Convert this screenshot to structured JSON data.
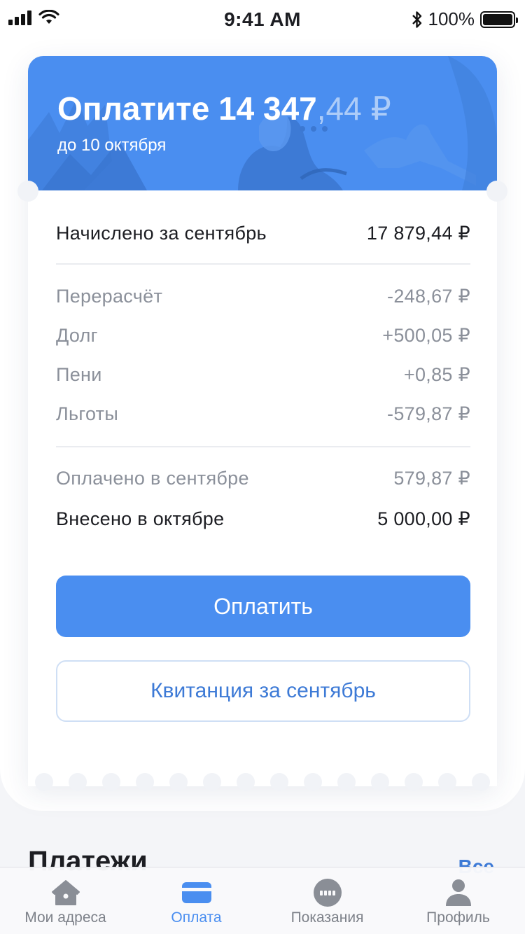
{
  "status_bar": {
    "time": "9:41 AM",
    "battery": "100%"
  },
  "banner": {
    "title_main": "Оплатите 14 347",
    "title_cents": ",44 ₽",
    "subtitle": "до 10 октября"
  },
  "charges": {
    "accrued": {
      "label": "Начислено за сентябрь",
      "value": "17 879,44 ₽"
    },
    "details": [
      {
        "label": "Перерасчёт",
        "value": "-248,67 ₽"
      },
      {
        "label": "Долг",
        "value": "+500,05 ₽"
      },
      {
        "label": "Пени",
        "value": "+0,85 ₽"
      },
      {
        "label": "Льготы",
        "value": "-579,87 ₽"
      }
    ],
    "paid_september": {
      "label": "Оплачено в сентябре",
      "value": "579,87 ₽"
    },
    "paid_october": {
      "label": "Внесено в октябре",
      "value": "5 000,00 ₽"
    }
  },
  "actions": {
    "pay_label": "Оплатить",
    "receipt_label": "Квитанция за сентябрь"
  },
  "payments_section": {
    "title": "Платежи",
    "link": "Все"
  },
  "tabbar": {
    "items": [
      {
        "label": "Мои адреса",
        "icon": "home-icon",
        "active": false
      },
      {
        "label": "Оплата",
        "icon": "card-icon",
        "active": true
      },
      {
        "label": "Показания",
        "icon": "meter-icon",
        "active": false
      },
      {
        "label": "Профиль",
        "icon": "profile-icon",
        "active": false
      }
    ]
  },
  "colors": {
    "accent": "#4a8ef0",
    "link": "#3d7ad6",
    "muted": "#8b909a",
    "text": "#1c1d22"
  }
}
